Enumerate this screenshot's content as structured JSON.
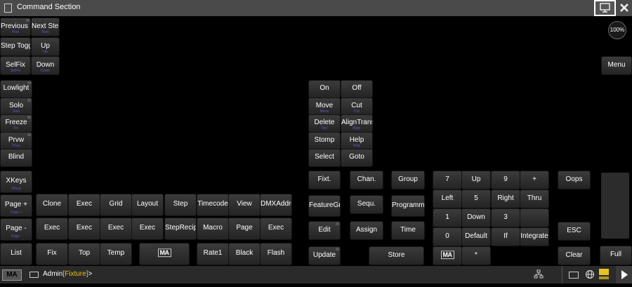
{
  "window": {
    "title": "Command Section",
    "zoom": "100%"
  },
  "command_line": {
    "user": "Admin",
    "object": "[Fixture]",
    "prompt": ">"
  },
  "buttons": {
    "prev_step": {
      "label": "Previous S",
      "sub": "Prev"
    },
    "next_step": {
      "label": "Next Step",
      "sub": "Next"
    },
    "step_toggle": {
      "label": "Step Toggl",
      "sub": ""
    },
    "up": {
      "label": "Up",
      "sub": "Up"
    },
    "selfix": {
      "label": "SelFix",
      "sub": "SelFix"
    },
    "down": {
      "label": "Down",
      "sub": "Down"
    },
    "menu": {
      "label": "Menu",
      "sub": ""
    },
    "lowlight": {
      "label": "Lowlight",
      "sub": ""
    },
    "solo": {
      "label": "Solo",
      "sub": "Solo"
    },
    "freeze": {
      "label": "Freeze",
      "sub": "Frz"
    },
    "prvw": {
      "label": "Prvw",
      "sub": "Prvw"
    },
    "blind": {
      "label": "Blind",
      "sub": ""
    },
    "on": {
      "label": "On",
      "sub": ""
    },
    "off": {
      "label": "Off",
      "sub": ""
    },
    "move": {
      "label": "Move",
      "sub": "Move"
    },
    "cut": {
      "label": "Cut",
      "sub": "Cut"
    },
    "delete": {
      "label": "Delete",
      "sub": "Del"
    },
    "align_transition": {
      "label": "AlignTransi",
      "sub": "Align"
    },
    "stomp": {
      "label": "Stomp",
      "sub": ""
    },
    "help": {
      "label": "Help",
      "sub": "Help"
    },
    "select": {
      "label": "Select",
      "sub": ""
    },
    "goto": {
      "label": "Goto",
      "sub": ""
    },
    "xkeys": {
      "label": "XKeys",
      "sub": "XKeys"
    },
    "fixt": {
      "label": "Fixt.",
      "sub": ""
    },
    "chan": {
      "label": "Chan.",
      "sub": ""
    },
    "group": {
      "label": "Group",
      "sub": ""
    },
    "page_plus": {
      "label": "Page +",
      "sub": "Page +"
    },
    "clone": {
      "label": "Clone",
      "sub": ""
    },
    "exec1": {
      "label": "Exec",
      "sub": ""
    },
    "grid": {
      "label": "Grid",
      "sub": ""
    },
    "layout": {
      "label": "Layout",
      "sub": ""
    },
    "step": {
      "label": "Step",
      "sub": ""
    },
    "timecode": {
      "label": "Timecode",
      "sub": ""
    },
    "view": {
      "label": "View",
      "sub": ""
    },
    "dmx_address": {
      "label": "DMXAddres",
      "sub": ""
    },
    "feature_group": {
      "label": "FeatureGrou",
      "sub": ""
    },
    "sequ": {
      "label": "Sequ.",
      "sub": ""
    },
    "programmer": {
      "label": "Programme",
      "sub": ""
    },
    "page_minus": {
      "label": "Page -",
      "sub": "Page -"
    },
    "exec2": {
      "label": "Exec",
      "sub": ""
    },
    "exec3": {
      "label": "Exec",
      "sub": ""
    },
    "exec4": {
      "label": "Exec",
      "sub": ""
    },
    "exec5": {
      "label": "Exec",
      "sub": ""
    },
    "step_recipe": {
      "label": "StepRecipe",
      "sub": ""
    },
    "macro": {
      "label": "Macro",
      "sub": ""
    },
    "page": {
      "label": "Page",
      "sub": ""
    },
    "exec6": {
      "label": "Exec",
      "sub": ""
    },
    "edit": {
      "label": "Edit",
      "sub": ""
    },
    "assign": {
      "label": "Assign",
      "sub": ""
    },
    "time": {
      "label": "Time",
      "sub": ""
    },
    "list": {
      "label": "List",
      "sub": ""
    },
    "fix": {
      "label": "Fix",
      "sub": ""
    },
    "top": {
      "label": "Top",
      "sub": ""
    },
    "temp": {
      "label": "Temp",
      "sub": ""
    },
    "ma_left": {
      "label": "MA",
      "sub": ""
    },
    "rate1": {
      "label": "Rate1",
      "sub": ""
    },
    "black": {
      "label": "Black",
      "sub": ""
    },
    "flash": {
      "label": "Flash",
      "sub": ""
    },
    "update": {
      "label": "Update",
      "sub": ""
    },
    "store": {
      "label": "Store",
      "sub": ""
    },
    "key7": {
      "label": "7",
      "sub": ""
    },
    "keyup": {
      "label": "Up",
      "sub": ""
    },
    "key9": {
      "label": "9",
      "sub": ""
    },
    "keyplus": {
      "label": "+",
      "sub": ""
    },
    "oops": {
      "label": "Oops",
      "sub": ""
    },
    "left": {
      "label": "Left",
      "sub": ""
    },
    "key5": {
      "label": "5",
      "sub": ""
    },
    "right": {
      "label": "Right",
      "sub": ""
    },
    "thru": {
      "label": "Thru",
      "sub": ""
    },
    "key1": {
      "label": "1",
      "sub": ""
    },
    "keydown": {
      "label": "Down",
      "sub": ""
    },
    "key3": {
      "label": "3",
      "sub": ""
    },
    "esc": {
      "label": "ESC",
      "sub": ""
    },
    "key0": {
      "label": "0",
      "sub": ""
    },
    "default": {
      "label": "Default",
      "sub": ""
    },
    "if": {
      "label": "If",
      "sub": ""
    },
    "integrate": {
      "label": "Integrate",
      "sub": ""
    },
    "ma_right": {
      "label": "MA",
      "sub": ""
    },
    "dot": {
      "label": "*",
      "sub": ""
    },
    "please": {
      "label": "",
      "sub": ""
    },
    "clear": {
      "label": "Clear",
      "sub": ""
    },
    "full": {
      "label": "Full",
      "sub": ""
    }
  },
  "colors": {
    "background": "#000000",
    "title_bar": "#4a4a4a",
    "button": "#2e2e2e",
    "command_text_highlight": "#e8c320",
    "sub_text": "#5b5bbf"
  }
}
